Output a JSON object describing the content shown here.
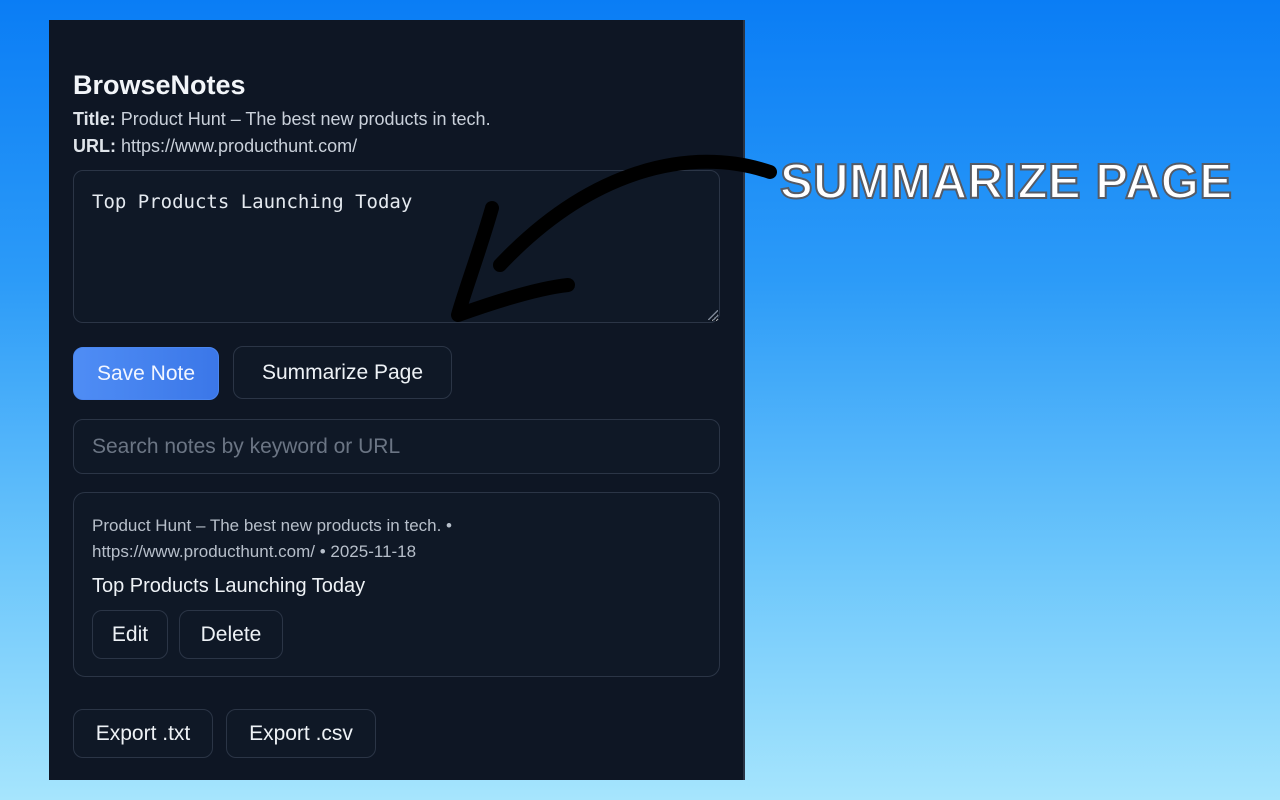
{
  "app": {
    "title": "BrowseNotes"
  },
  "page_info": {
    "title_label": "Title:",
    "title_value": "Product Hunt – The best new products in tech.",
    "url_label": "URL:",
    "url_value": "https://www.producthunt.com/"
  },
  "editor": {
    "value": "Top Products Launching Today"
  },
  "actions": {
    "save_label": "Save Note",
    "summarize_label": "Summarize Page"
  },
  "search": {
    "placeholder": "Search notes by keyword or URL"
  },
  "notes": [
    {
      "meta_line1": "Product Hunt – The best new products in tech. •",
      "meta_line2": "https://www.producthunt.com/ • 2025-11-18",
      "text": "Top Products Launching Today",
      "edit_label": "Edit",
      "delete_label": "Delete"
    }
  ],
  "export": {
    "txt_label": "Export .txt",
    "csv_label": "Export .csv"
  },
  "callout": {
    "text": "SUMMARIZE PAGE"
  },
  "colors": {
    "accent": "#4f8df5",
    "panel_bg": "#0e1624"
  }
}
